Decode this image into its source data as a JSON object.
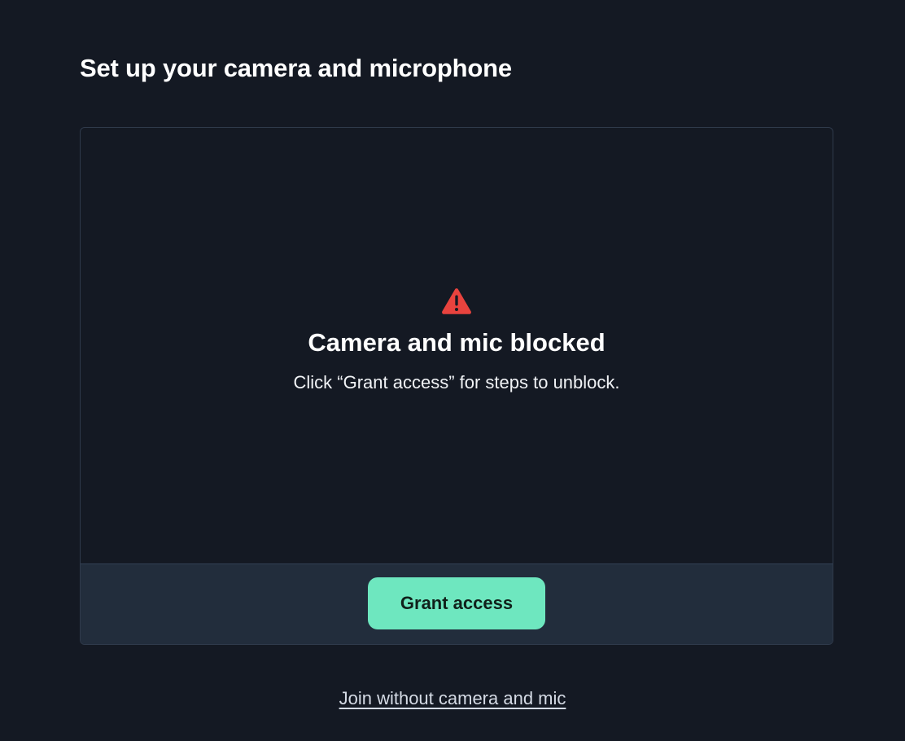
{
  "page": {
    "title": "Set up your camera and microphone"
  },
  "preview": {
    "status_icon": "warning-triangle-icon",
    "status_title": "Camera and mic blocked",
    "status_message": "Click “Grant access” for steps to unblock."
  },
  "actions": {
    "grant_access_label": "Grant access",
    "join_without_label": "Join without camera and mic"
  },
  "colors": {
    "background": "#141923",
    "card_footer": "#222d3c",
    "accent": "#6ee7bf",
    "warning": "#e8433e",
    "link": "#d5dbe5"
  }
}
